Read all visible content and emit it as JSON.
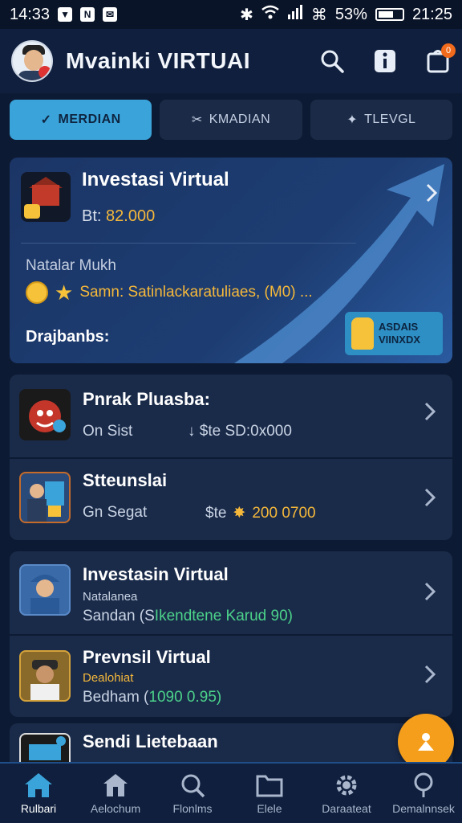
{
  "status_bar": {
    "time_left": "14:33",
    "battery": "53%",
    "time_right": "21:25"
  },
  "header": {
    "app_title": "Mvainki VIRTUAI",
    "notification_count": "0"
  },
  "tabs": [
    {
      "label": "MERDIAN",
      "icon": "check-icon",
      "active": true
    },
    {
      "label": "KMADIAN",
      "icon": "scissors-icon",
      "active": false
    },
    {
      "label": "TLEVGL",
      "icon": "tools-icon",
      "active": false
    }
  ],
  "hero": {
    "title": "Investasi Virtual",
    "sub_prefix": "Bt:",
    "sub_value": "82.000",
    "meta": "Natalar Mukh",
    "line": "Samn: Satinlackaratuliaes, (M0) ...",
    "footer": "Drajbanbs:",
    "badge_line1": "ASDAIS",
    "badge_line2": "VIINXDX"
  },
  "list_group_1": [
    {
      "title": "Pnrak Pluasba:",
      "sub_left": "On Sist",
      "sub_mid": "↓ $te  SD:0x000"
    },
    {
      "title": "Stteunslai",
      "sub_left": "Gn Segat",
      "sub_mid": "$te",
      "sub_value": "200 0700"
    }
  ],
  "list_group_2": [
    {
      "title": "Investasin Virtual",
      "line1": "Natalanea",
      "line2_prefix": "Sandan (S",
      "line2_value": "Ikendtene Karud 90)"
    },
    {
      "title": "Prevnsil Virtual",
      "line1": "Dealohiat",
      "line2_prefix": "Bedham (",
      "line2_value": "1090 0.95)"
    }
  ],
  "list_group_3": {
    "title": "Sendi Lietebaan"
  },
  "bottom_nav": [
    {
      "label": "Rulbari",
      "icon": "home-icon",
      "active": true
    },
    {
      "label": "Aelochum",
      "icon": "house-icon",
      "active": false
    },
    {
      "label": "Flonlms",
      "icon": "search-icon",
      "active": false
    },
    {
      "label": "Elele",
      "icon": "folder-icon",
      "active": false
    },
    {
      "label": "Daraateat",
      "icon": "gear-icon",
      "active": false
    },
    {
      "label": "Demalnnsek",
      "icon": "location-icon",
      "active": false
    }
  ],
  "colors": {
    "accent": "#3aa3d9",
    "gold": "#f5b83a",
    "fab": "#f59e1b",
    "bg": "#0d1a33"
  }
}
